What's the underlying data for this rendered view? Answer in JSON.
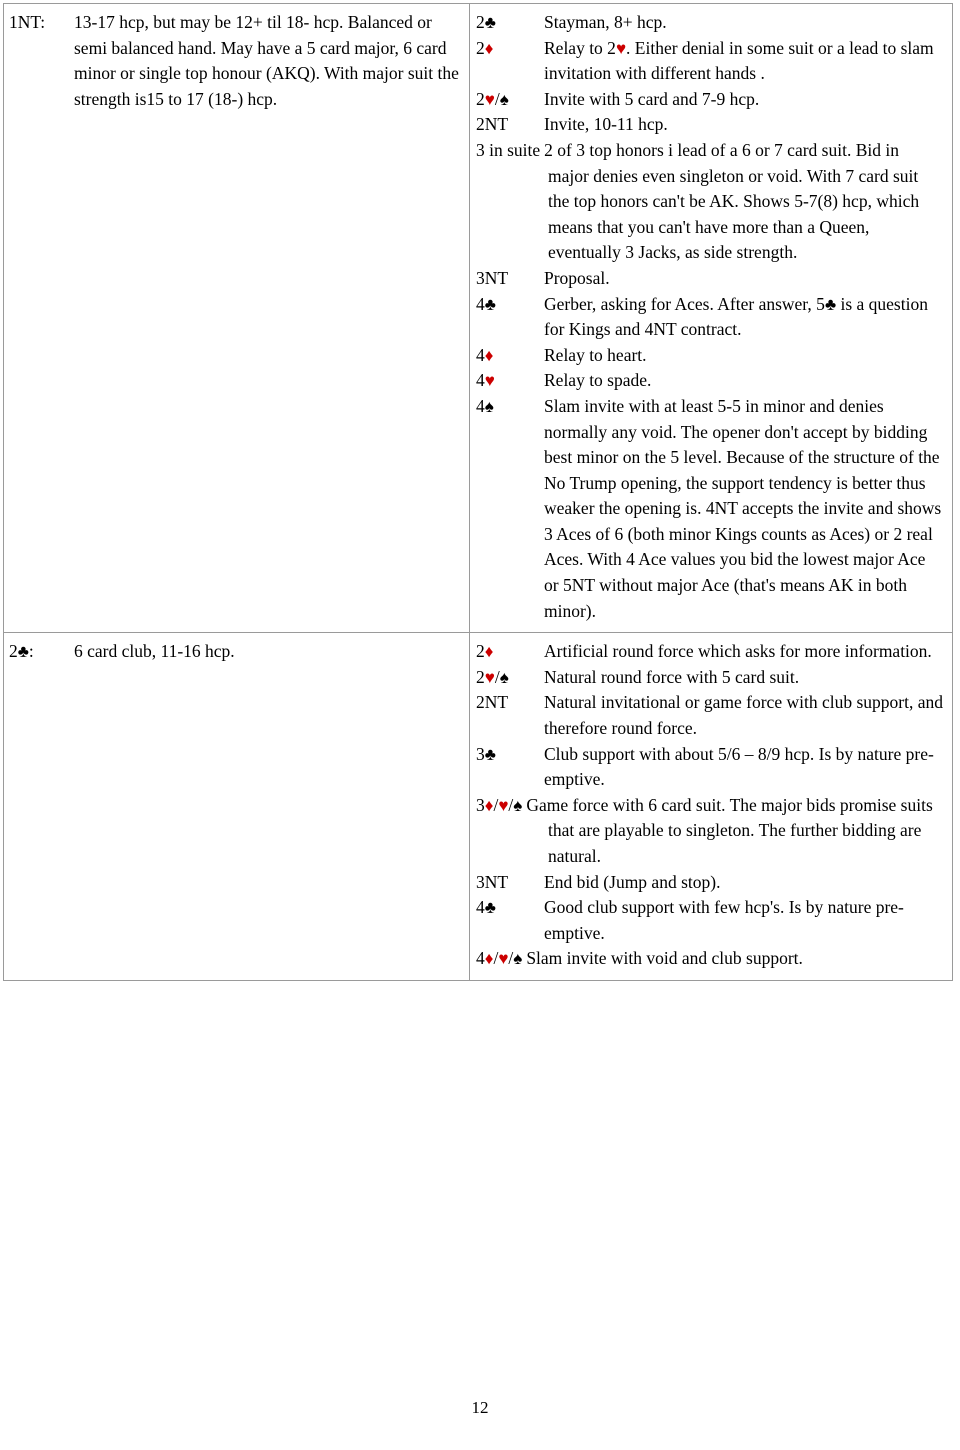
{
  "document": {
    "page_number": "12",
    "colors": {
      "red_suit": "#cc0000",
      "black_suit": "#000000",
      "border": "#9a9a9a",
      "text": "#000000",
      "background": "#ffffff"
    }
  },
  "suits": {
    "club": "♣",
    "diamond": "♦",
    "heart": "♥",
    "spade": "♠"
  },
  "table": {
    "sections": [
      {
        "opening": {
          "bid_label": "1NT:",
          "description": "13-17 hcp, but may be 12+ til 18- hcp. Balanced or semi balanced hand. May have a 5 card major, 6 card minor or single top honour (AKQ). With major suit the strength is15 to 17 (18-) hcp."
        },
        "responses": [
          {
            "bid_parts": [
              {
                "text": "2",
                "type": "plain"
              },
              {
                "text": "♣",
                "type": "suit",
                "color": "black"
              }
            ],
            "bid_plain": "2♣",
            "layout": "column",
            "description": "Stayman, 8+ hcp."
          },
          {
            "bid_parts": [
              {
                "text": "2",
                "type": "plain"
              },
              {
                "text": "♦",
                "type": "suit",
                "color": "red"
              }
            ],
            "bid_plain": "2♦",
            "layout": "column",
            "desc_parts": [
              {
                "text": "Relay to 2",
                "type": "plain"
              },
              {
                "text": "♥",
                "type": "suit",
                "color": "red"
              },
              {
                "text": ". Either denial in some suit or a lead to slam invitation with different hands .",
                "type": "plain"
              }
            ],
            "description": "Relay to 2♥. Either denial in some suit or a lead to slam invitation with different hands ."
          },
          {
            "bid_parts": [
              {
                "text": "2",
                "type": "plain"
              },
              {
                "text": "♥",
                "type": "suit",
                "color": "red"
              },
              {
                "text": "/",
                "type": "plain"
              },
              {
                "text": "♠",
                "type": "suit",
                "color": "black"
              }
            ],
            "bid_plain": "2♥/♠",
            "layout": "column",
            "description": "Invite with 5 card and 7-9 hcp."
          },
          {
            "bid_parts": [
              {
                "text": "2NT",
                "type": "plain"
              }
            ],
            "bid_plain": "2NT",
            "layout": "column",
            "description": "Invite, 10-11 hcp."
          },
          {
            "bid_parts": [
              {
                "text": "3 in suite",
                "type": "plain"
              }
            ],
            "bid_plain": "3 in suite",
            "layout": "hang",
            "description": "2 of 3 top honors i lead of a 6 or 7 card suit. Bid in major denies even singleton or void. With 7 card suit the top honors can't be AK. Shows 5-7(8) hcp, which means that you can't have more than a Queen, eventually 3 Jacks, as side strength."
          },
          {
            "bid_parts": [
              {
                "text": "3NT",
                "type": "plain"
              }
            ],
            "bid_plain": "3NT",
            "layout": "column",
            "description": "Proposal."
          },
          {
            "bid_parts": [
              {
                "text": "4",
                "type": "plain"
              },
              {
                "text": "♣",
                "type": "suit",
                "color": "black"
              }
            ],
            "bid_plain": "4♣",
            "layout": "column",
            "desc_parts": [
              {
                "text": "Gerber, asking for Aces. After answer, 5",
                "type": "plain"
              },
              {
                "text": "♣",
                "type": "suit",
                "color": "black"
              },
              {
                "text": " is a question for Kings and 4NT contract.",
                "type": "plain"
              }
            ],
            "description": "Gerber, asking for Aces. After answer, 5♣ is a question for Kings and 4NT contract."
          },
          {
            "bid_parts": [
              {
                "text": "4",
                "type": "plain"
              },
              {
                "text": "♦",
                "type": "suit",
                "color": "red"
              }
            ],
            "bid_plain": "4♦",
            "layout": "column",
            "description": "Relay to heart."
          },
          {
            "bid_parts": [
              {
                "text": "4",
                "type": "plain"
              },
              {
                "text": "♥",
                "type": "suit",
                "color": "red"
              }
            ],
            "bid_plain": "4♥",
            "layout": "column",
            "description": "Relay to spade."
          },
          {
            "bid_parts": [
              {
                "text": "4",
                "type": "plain"
              },
              {
                "text": "♠",
                "type": "suit",
                "color": "black"
              }
            ],
            "bid_plain": "4♠",
            "layout": "column",
            "description": "Slam invite with at least 5-5 in minor and denies normally any void. The opener don't accept by bidding best minor on the 5 level. Because of the structure of the No Trump opening, the support tendency is better thus weaker the opening is. 4NT accepts the invite and shows 3 Aces of 6 (both minor Kings counts as Aces) or 2 real Aces. With 4 Ace values you bid the lowest major Ace or 5NT without major Ace (that's means AK in both minor)."
          }
        ]
      },
      {
        "opening": {
          "bid_parts": [
            {
              "text": "2",
              "type": "plain"
            },
            {
              "text": "♣",
              "type": "suit",
              "color": "black"
            },
            {
              "text": ":",
              "type": "plain"
            }
          ],
          "bid_label": "2♣:",
          "description": "6 card club, 11-16 hcp."
        },
        "responses": [
          {
            "bid_parts": [
              {
                "text": "2",
                "type": "plain"
              },
              {
                "text": "♦",
                "type": "suit",
                "color": "red"
              }
            ],
            "bid_plain": "2♦",
            "layout": "column",
            "description": "Artificial round force which asks for more information."
          },
          {
            "bid_parts": [
              {
                "text": "2",
                "type": "plain"
              },
              {
                "text": "♥",
                "type": "suit",
                "color": "red"
              },
              {
                "text": "/",
                "type": "plain"
              },
              {
                "text": "♠",
                "type": "suit",
                "color": "black"
              }
            ],
            "bid_plain": "2♥/♠",
            "layout": "column",
            "description": "Natural round force with 5 card suit."
          },
          {
            "bid_parts": [
              {
                "text": "2NT",
                "type": "plain"
              }
            ],
            "bid_plain": "2NT",
            "layout": "column",
            "description": "Natural invitational or game force with club support, and therefore round force."
          },
          {
            "bid_parts": [
              {
                "text": "3",
                "type": "plain"
              },
              {
                "text": "♣",
                "type": "suit",
                "color": "black"
              }
            ],
            "bid_plain": "3♣",
            "layout": "column",
            "description": "Club support with about 5/6 – 8/9 hcp. Is by nature pre-emptive."
          },
          {
            "bid_parts": [
              {
                "text": "3",
                "type": "plain"
              },
              {
                "text": "♦",
                "type": "suit",
                "color": "red"
              },
              {
                "text": "/",
                "type": "plain"
              },
              {
                "text": "♥",
                "type": "suit",
                "color": "red"
              },
              {
                "text": "/",
                "type": "plain"
              },
              {
                "text": "♠",
                "type": "suit",
                "color": "black"
              }
            ],
            "bid_plain": "3♦/♥/♠",
            "layout": "hang",
            "description": "Game force with 6 card suit. The major bids promise suits that are playable to singleton. The further bidding are natural."
          },
          {
            "bid_parts": [
              {
                "text": "3NT",
                "type": "plain"
              }
            ],
            "bid_plain": "3NT",
            "layout": "column",
            "description": "End bid (Jump and stop)."
          },
          {
            "bid_parts": [
              {
                "text": "4",
                "type": "plain"
              },
              {
                "text": "♣",
                "type": "suit",
                "color": "black"
              }
            ],
            "bid_plain": "4♣",
            "layout": "column",
            "description": "Good club support with few hcp's. Is by nature pre-emptive."
          },
          {
            "bid_parts": [
              {
                "text": "4",
                "type": "plain"
              },
              {
                "text": "♦",
                "type": "suit",
                "color": "red"
              },
              {
                "text": "/",
                "type": "plain"
              },
              {
                "text": "♥",
                "type": "suit",
                "color": "red"
              },
              {
                "text": "/",
                "type": "plain"
              },
              {
                "text": "♠",
                "type": "suit",
                "color": "black"
              }
            ],
            "bid_plain": "4♦/♥/♠",
            "layout": "hang",
            "description": "Slam invite with void and club support."
          }
        ]
      }
    ]
  }
}
